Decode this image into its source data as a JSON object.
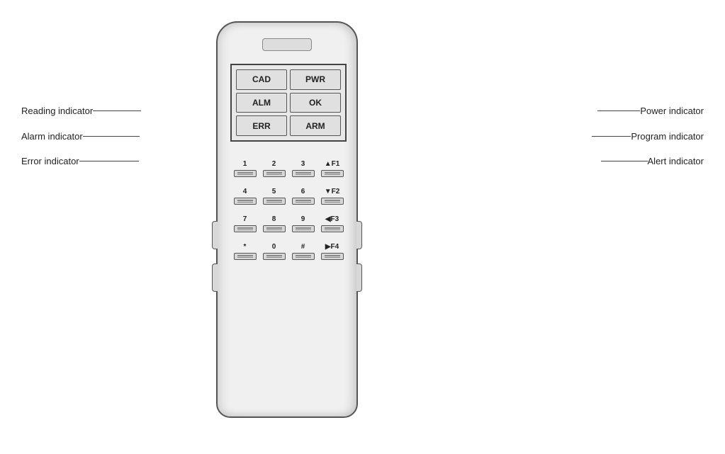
{
  "labels": {
    "reading_indicator": "Reading indicator",
    "alarm_indicator": "Alarm indicator",
    "error_indicator": "Error indicator",
    "power_indicator": "Power indicator",
    "program_indicator": "Program indicator",
    "alert_indicator": "Alert indicator"
  },
  "indicators": {
    "cad": "CAD",
    "alm": "ALM",
    "err": "ERR",
    "pwr": "PWR",
    "ok": "OK",
    "arm": "ARM"
  },
  "keys": [
    {
      "label": "1",
      "row": 0,
      "col": 0
    },
    {
      "label": "2",
      "row": 0,
      "col": 1
    },
    {
      "label": "3",
      "row": 0,
      "col": 2
    },
    {
      "label": "▲F1",
      "row": 0,
      "col": 3
    },
    {
      "label": "4",
      "row": 1,
      "col": 0
    },
    {
      "label": "5",
      "row": 1,
      "col": 1
    },
    {
      "label": "6",
      "row": 1,
      "col": 2
    },
    {
      "label": "▼F2",
      "row": 1,
      "col": 3
    },
    {
      "label": "7",
      "row": 2,
      "col": 0
    },
    {
      "label": "8",
      "row": 2,
      "col": 1
    },
    {
      "label": "9",
      "row": 2,
      "col": 2
    },
    {
      "label": "◀F3",
      "row": 2,
      "col": 3
    },
    {
      "label": "*",
      "row": 3,
      "col": 0
    },
    {
      "label": "0",
      "row": 3,
      "col": 1
    },
    {
      "label": "#",
      "row": 3,
      "col": 2
    },
    {
      "label": "▶F4",
      "row": 3,
      "col": 3
    }
  ],
  "colors": {
    "device_bg": "#f0f0f0",
    "border": "#555555",
    "indicator_bg": "#e0e0e0"
  }
}
